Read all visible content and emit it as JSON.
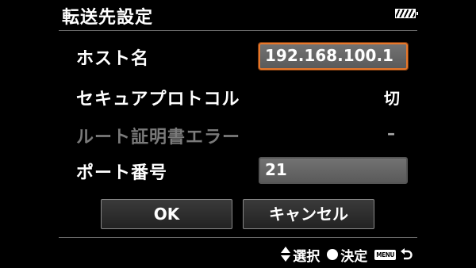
{
  "header": {
    "title": "転送先設定",
    "battery_icon": "battery-icon"
  },
  "rows": [
    {
      "label": "ホスト名",
      "value": "192.168.100.1",
      "type": "field",
      "state": "focused"
    },
    {
      "label": "セキュアプロトコル",
      "value": "切",
      "type": "value",
      "state": "normal"
    },
    {
      "label": "ルート証明書エラー",
      "value": "–",
      "type": "value",
      "state": "disabled"
    },
    {
      "label": "ポート番号",
      "value": "21",
      "type": "field",
      "state": "normal"
    }
  ],
  "buttons": {
    "ok_label": "OK",
    "cancel_label": "キャンセル"
  },
  "footer": {
    "select_label": "選択",
    "confirm_label": "決定",
    "menu_badge": "MENU",
    "icons": [
      "up-down-icon",
      "circle-button-icon",
      "menu-button-icon",
      "return-icon"
    ]
  },
  "colors": {
    "background": "#000000",
    "focus_border": "#e8772a",
    "field_fill": "#666666",
    "disabled_text": "#7a7a7a"
  }
}
